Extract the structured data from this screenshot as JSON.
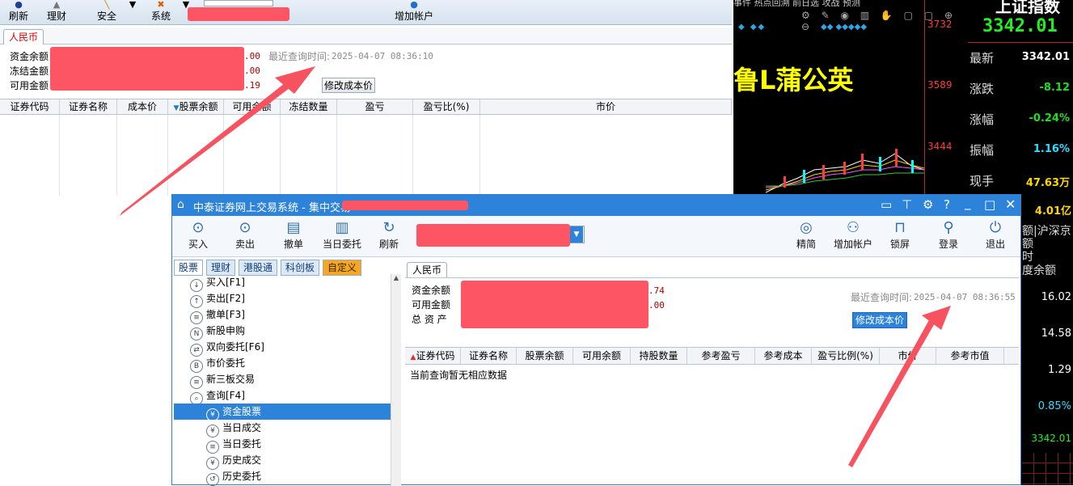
{
  "back": {
    "toolbar": {
      "refresh": "刷新",
      "finance": "理财",
      "security": "安全",
      "system": "系统",
      "add_account": "增加帐户"
    },
    "tab": "人民币",
    "labels": {
      "fund_balance": "资金余额",
      "frozen": "冻结金额",
      "available": "可用金额"
    },
    "values": {
      "fund_balance": ".00",
      "frozen": ".00",
      "available": ".19"
    },
    "last_query_label": "最近查询时间:",
    "last_query_time": "2025-04-07 08:36:10",
    "modify_cost_button": "修改成本价",
    "columns": [
      "证券代码",
      "证券名称",
      "成本价",
      "股票余额",
      "可用余额",
      "冻结数量",
      "盈亏",
      "盈亏比(%)",
      "市价"
    ]
  },
  "chart": {
    "tabs_text": "事件 热点回溯 前日选 攻战 预测",
    "ticks": [
      "3732",
      "3589",
      "3444"
    ],
    "overlay_text": "鲁L蒲公英"
  },
  "quotes": {
    "index_name": "上证指数",
    "index_value": "3342.01",
    "rows": [
      {
        "label": "最新",
        "value": "3342.01",
        "color": "#ffffff"
      },
      {
        "label": "涨跌",
        "value": "-8.12",
        "color": "#22dd22"
      },
      {
        "label": "涨幅",
        "value": "-0.24%",
        "color": "#22dd22"
      },
      {
        "label": "振幅",
        "value": "1.16%",
        "color": "#33ddff"
      },
      {
        "label": "现手",
        "value": "47.63万",
        "color": "#ffd700"
      }
    ],
    "strip": {
      "amount": "4.01亿",
      "text1": "额|沪深京",
      "text2": "额",
      "text3": "时",
      "text4": "度余额",
      "v1": "16.02",
      "v2": "14.58",
      "v3": "1.29",
      "v4": "0.85%",
      "v5": "3342.01"
    }
  },
  "front": {
    "title": "中泰证券网上交易系统 - 集中交易",
    "toolbar": {
      "buy": "买入",
      "sell": "卖出",
      "cancel": "撤单",
      "today_orders": "当日委托",
      "refresh": "刷新",
      "simple": "精简",
      "add_account": "增加帐户",
      "lock": "锁屏",
      "login": "登录",
      "exit": "退出"
    },
    "left_tabs": [
      "股票",
      "理财",
      "港股通",
      "科创板",
      "自定义"
    ],
    "tree": [
      {
        "label": "买入[F1]",
        "icon": "down-arrow-icon",
        "glyph": "↓"
      },
      {
        "label": "卖出[F2]",
        "icon": "up-arrow-icon",
        "glyph": "↑"
      },
      {
        "label": "撤单[F3]",
        "icon": "cancel-order-icon",
        "glyph": "≡"
      },
      {
        "label": "新股申购",
        "icon": "new-icon",
        "glyph": "N"
      },
      {
        "label": "双向委托[F6]",
        "icon": "swap-icon",
        "glyph": "⇄"
      },
      {
        "label": "市价委托",
        "icon": "market-order-icon",
        "glyph": "B"
      },
      {
        "label": "新三板交易",
        "icon": "document-icon",
        "glyph": "≡"
      },
      {
        "label": "查询[F4]",
        "icon": "search-icon",
        "glyph": "⌕"
      },
      {
        "label": "资金股票",
        "icon": "yuan-icon",
        "glyph": "¥"
      },
      {
        "label": "当日成交",
        "icon": "yuan-icon",
        "glyph": "¥"
      },
      {
        "label": "当日委托",
        "icon": "list-icon",
        "glyph": "≡"
      },
      {
        "label": "历史成交",
        "icon": "yuan-icon",
        "glyph": "¥"
      },
      {
        "label": "历史委托",
        "icon": "history-icon",
        "glyph": "↺"
      }
    ],
    "tab": "人民币",
    "labels": {
      "fund_balance": "资金余额",
      "available": "可用金额",
      "total_assets": "总 资 产"
    },
    "values": {
      "fund_balance": ".74",
      "available": ".00"
    },
    "last_query_label": "最近查询时间:",
    "last_query_time": "2025-04-07 08:36:55",
    "modify_cost_button": "修改成本价",
    "columns": [
      "证券代码",
      "证券名称",
      "股票余额",
      "可用余额",
      "持股数量",
      "参考盈亏",
      "参考成本",
      "盈亏比例(%)",
      "市价",
      "参考市值"
    ],
    "empty_message": "当前查询暂无相应数据"
  },
  "colors": {
    "accent": "#2d83d9",
    "redaction": "#fd5563",
    "arrow": "#f7525f"
  }
}
